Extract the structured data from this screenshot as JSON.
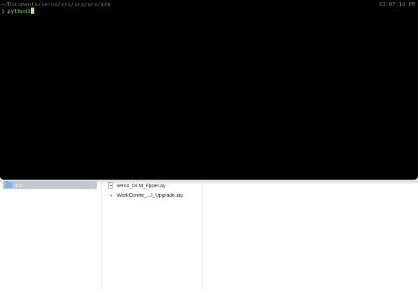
{
  "terminal": {
    "path_prefix": "~/Documents/xerox/xrx/xrx/xrx/",
    "path_current": "xrx",
    "clock": "03:07:14 PM",
    "prompt_symbol": "❯",
    "command": "python3"
  },
  "browser": {
    "column1": {
      "items": [
        {
          "label": "xrx",
          "icon": "folder-icon",
          "selected": true
        }
      ]
    },
    "column2": {
      "items": [
        {
          "label": "xerox_DLM_ripper.py",
          "icon": "python-file-icon"
        },
        {
          "label": "WorkCentre_...l_Upgrade.zip",
          "icon": "alias-zip-icon"
        }
      ]
    }
  },
  "colors": {
    "terminal_bg": "#000000",
    "prompt_green": "#6fbf4b",
    "path_blue": "#4aa4d6",
    "selection_gray": "#c3c7ce"
  }
}
